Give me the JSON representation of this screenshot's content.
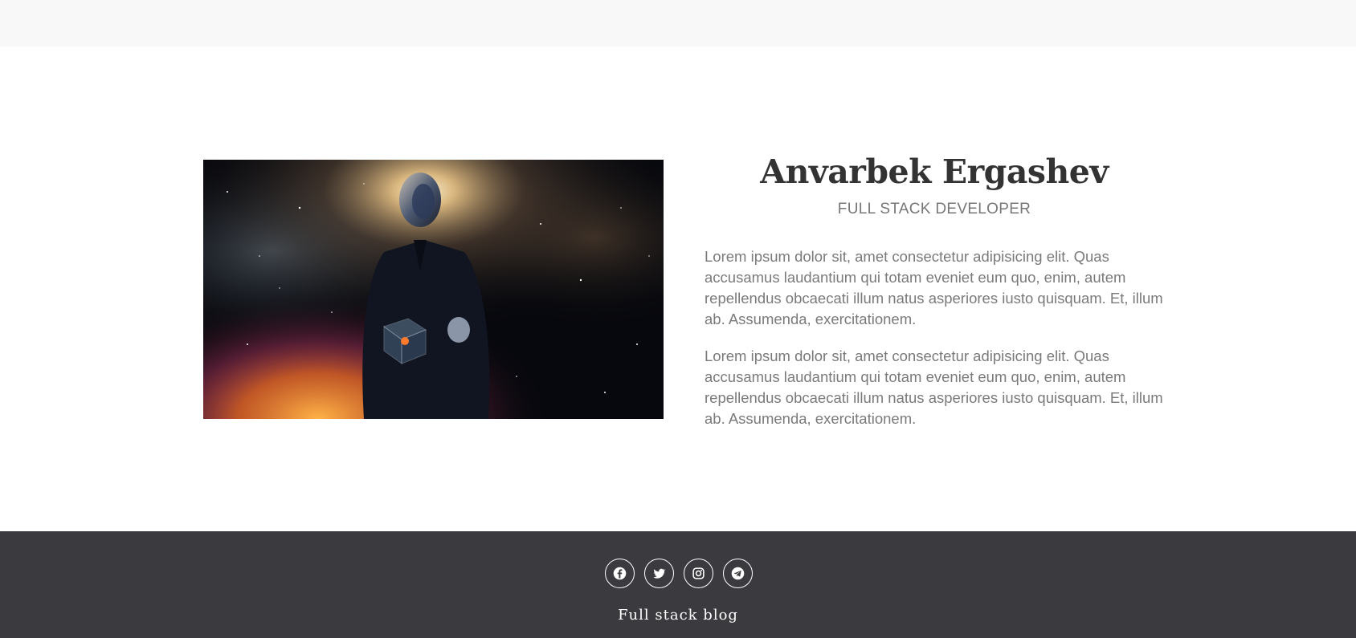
{
  "profile": {
    "name": "Anvarbek Ergashev",
    "role": "FULL STACK DEVELOPER",
    "paragraphs": [
      "Lorem ipsum dolor sit, amet consectetur adipisicing elit. Quas accusamus laudantium qui totam eveniet eum quo, enim, autem repellendus obcaecati illum natus asperiores iusto quisquam. Et, illum ab. Assumenda, exercitationem.",
      "Lorem ipsum dolor sit, amet consectetur adipisicing elit. Quas accusamus laudantium qui totam eveniet eum quo, enim, autem repellendus obcaecati illum natus asperiores iusto quisquam. Et, illum ab. Assumenda, exercitationem."
    ]
  },
  "footer": {
    "socials": [
      "facebook-icon",
      "twitter-icon",
      "instagram-icon",
      "telegram-icon"
    ],
    "title": "Full stack blog"
  },
  "colors": {
    "topbar": "#f8f8f8",
    "footer_bg": "#3b3a3e",
    "heading": "#333333",
    "body_text": "#7a7a7a"
  }
}
